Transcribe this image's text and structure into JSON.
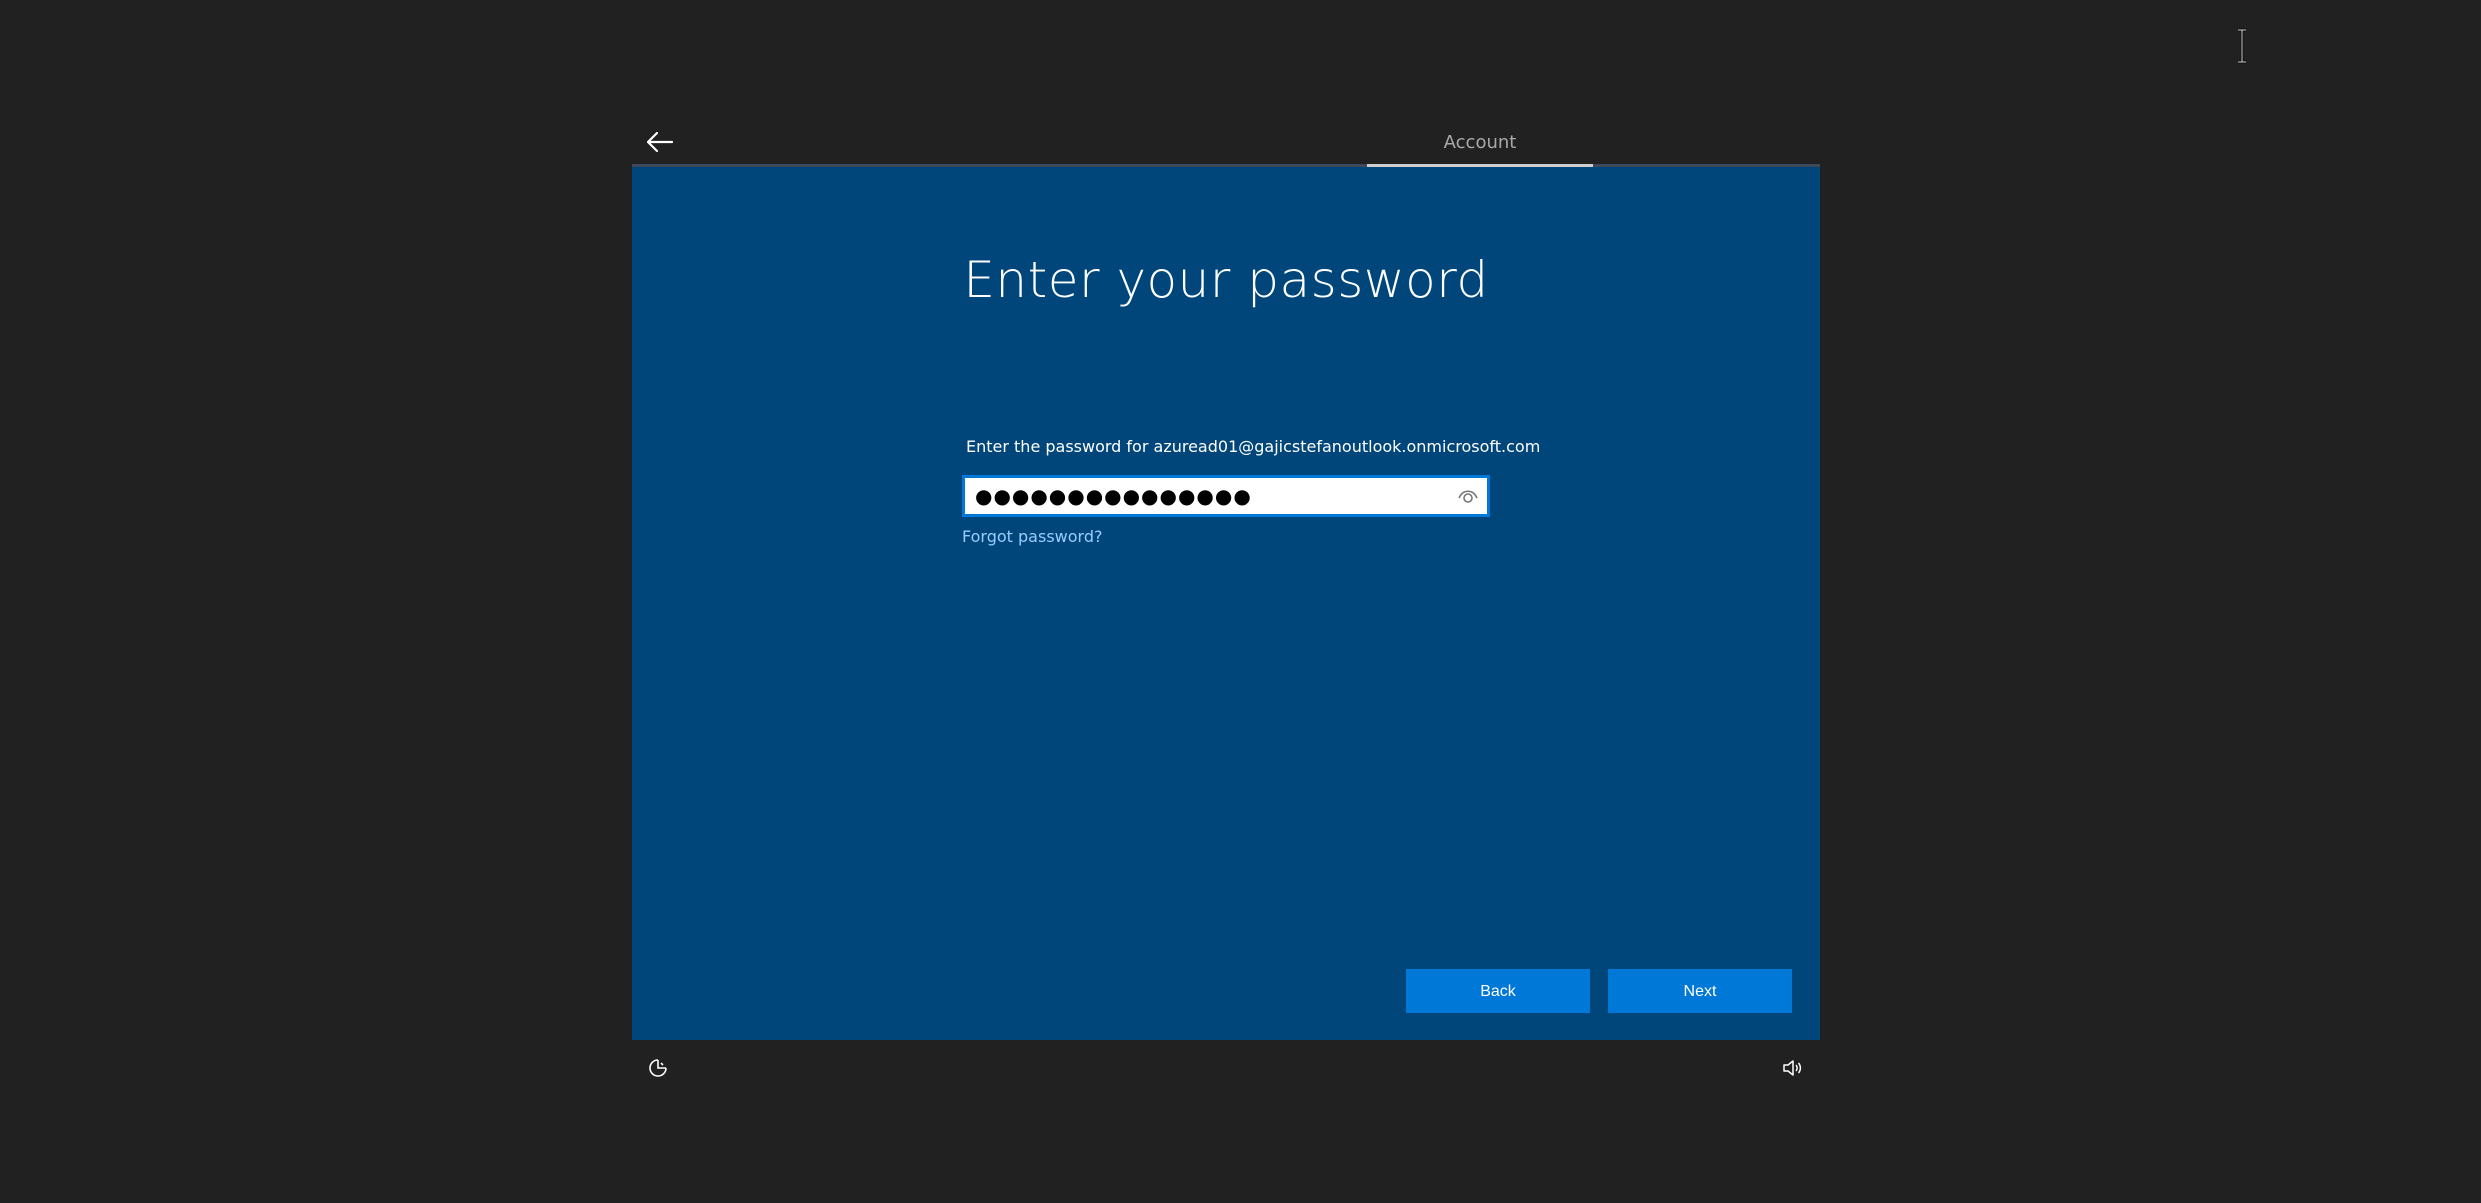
{
  "header": {
    "back_icon": "back-arrow-icon",
    "step_label": "Account"
  },
  "panel": {
    "title": "Enter your password",
    "instruction": "Enter the password for azuread01@gajicstefanoutlook.onmicrosoft.com",
    "password_masked": "●●●●●●●●●●●●●●●",
    "reveal_icon": "eye-icon",
    "forgot_link": "Forgot password?",
    "back_button": "Back",
    "next_button": "Next"
  },
  "footer": {
    "left_icon": "ease-of-access-icon",
    "right_icon": "volume-icon"
  },
  "colors": {
    "background": "#212121",
    "panel": "#00467a",
    "accent": "#0078d7",
    "link": "#99ccff"
  }
}
